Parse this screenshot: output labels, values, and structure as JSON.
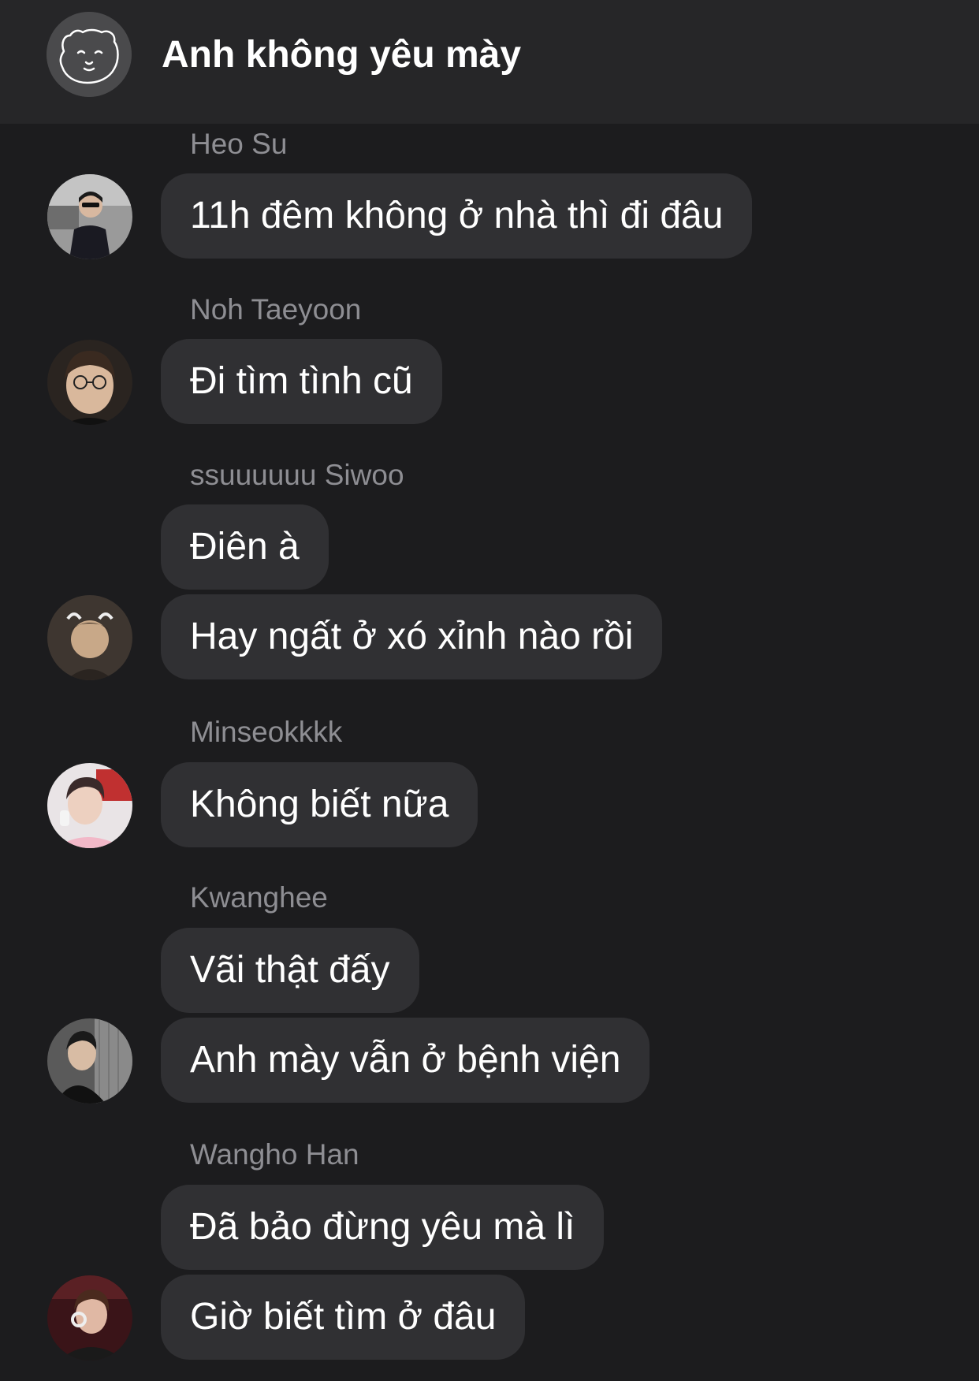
{
  "header": {
    "title": "Anh không yêu mày",
    "avatar_icon": "bear-face-icon"
  },
  "messages": [
    {
      "sender": "Heo Su",
      "text": "11h đêm không ở nhà thì đi đâu"
    },
    {
      "sender": "Noh Taeyoon",
      "text": "Đi tìm tình cũ"
    },
    {
      "sender": "ssuuuuuu Siwoo",
      "text": "Điên à"
    },
    {
      "sender": "",
      "text": "Hay ngất ở xó xỉnh nào rồi"
    },
    {
      "sender": "Minseokkkk",
      "text": "Không biết nữa"
    },
    {
      "sender": "Kwanghee",
      "text": "Vãi thật đấy"
    },
    {
      "sender": "",
      "text": "Anh mày vẫn ở bệnh viện"
    },
    {
      "sender": "Wangho Han",
      "text": "Đã bảo đừng yêu mà lì"
    },
    {
      "sender": "",
      "text": "Giờ biết tìm ở đâu"
    }
  ],
  "colors": {
    "background": "#1c1c1e",
    "header": "#262628",
    "bubble": "#303033",
    "sender_name": "#8e8e93",
    "text": "#ffffff"
  }
}
